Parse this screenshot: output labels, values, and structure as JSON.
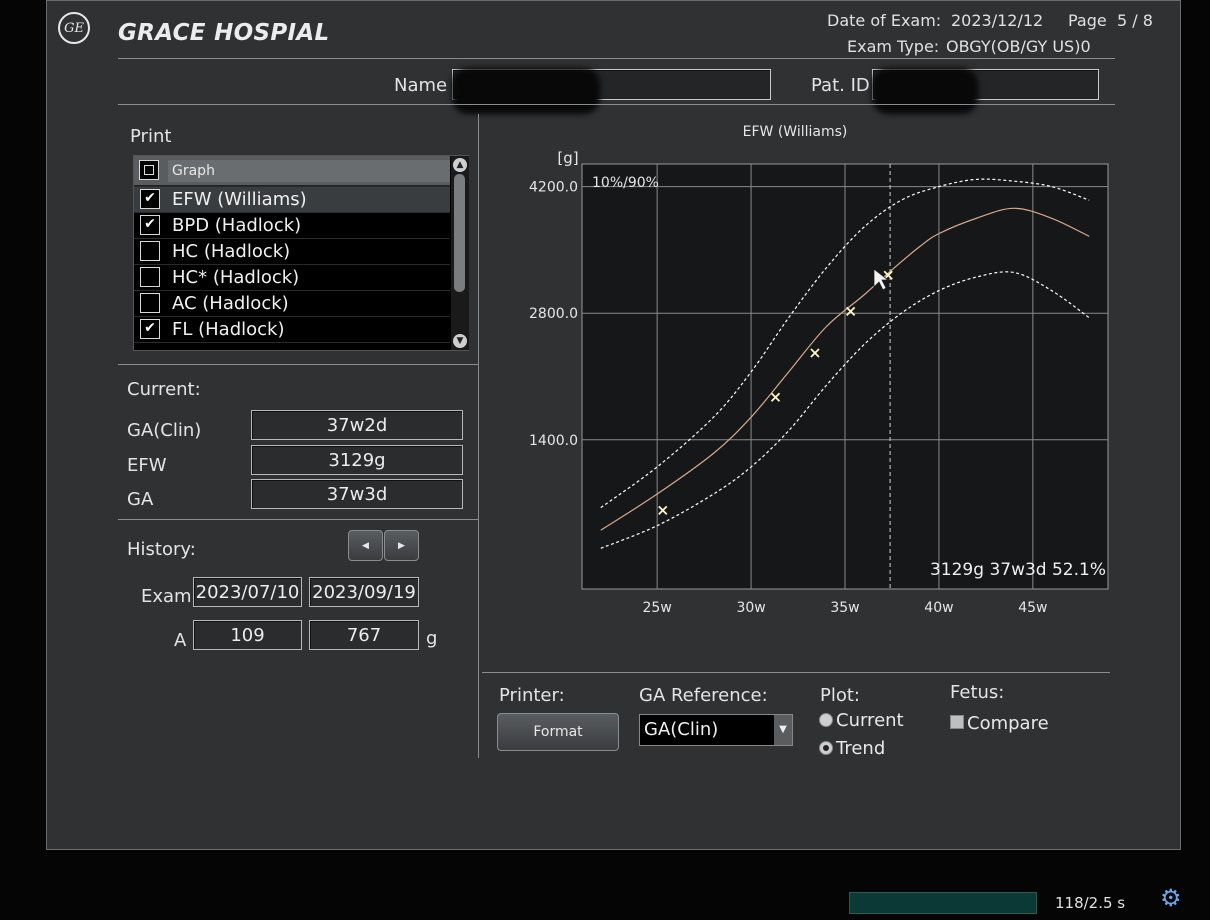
{
  "header": {
    "hospital": "GRACE HOSPIAL",
    "date_label": "Date of Exam:",
    "date_value": "2023/12/12",
    "page_label": "Page",
    "page_value": "5 / 8",
    "exam_type_label": "Exam Type:",
    "exam_type_value": "OBGY(OB/GY US)0",
    "name_label": "Name",
    "patid_label": "Pat. ID"
  },
  "print": {
    "title": "Print",
    "header_label": "Graph",
    "items": [
      {
        "label": "EFW (Williams)",
        "checked": true,
        "selected": true
      },
      {
        "label": "BPD (Hadlock)",
        "checked": true
      },
      {
        "label": "HC (Hadlock)",
        "checked": false
      },
      {
        "label": "HC* (Hadlock)",
        "checked": false
      },
      {
        "label": "AC (Hadlock)",
        "checked": false
      },
      {
        "label": "FL (Hadlock)",
        "checked": true
      }
    ]
  },
  "current": {
    "title": "Current:",
    "ga_clin_label": "GA(Clin)",
    "ga_clin_value": "37w2d",
    "efw_label": "EFW",
    "efw_value": "3129g",
    "ga_label": "GA",
    "ga_value": "37w3d"
  },
  "history": {
    "title": "History:",
    "exam_label": "Exam",
    "a_label": "A",
    "unit": "g",
    "exams": [
      "2023/07/10",
      "2023/09/19"
    ],
    "values": [
      "109",
      "767"
    ]
  },
  "bottom": {
    "printer_label": "Printer:",
    "format_button": "Format",
    "ga_ref_label": "GA Reference:",
    "ga_ref_value": "GA(Clin)",
    "plot_label": "Plot:",
    "plot_current": "Current",
    "plot_trend": "Trend",
    "plot_selected": "Trend",
    "fetus_label": "Fetus:",
    "compare_label": "Compare",
    "compare_checked": false
  },
  "status": {
    "timer": "118/2.5 s"
  },
  "chart_data": {
    "type": "line",
    "title": "EFW (Williams)",
    "ylabel": "[g]",
    "annotation": "10%/90%",
    "result_text": "3129g 37w3d 52.1%",
    "xlim": [
      21,
      49
    ],
    "ylim": [
      -250,
      4450
    ],
    "x_ticks": [
      25,
      30,
      35,
      40,
      45
    ],
    "x_tick_labels": [
      "25w",
      "30w",
      "35w",
      "40w",
      "45w"
    ],
    "y_ticks": [
      1400,
      2800,
      4200
    ],
    "y_tick_labels": [
      "1400.0",
      "2800.0",
      "4200.0"
    ],
    "marker_x": 37.4,
    "series": [
      {
        "style": "solid",
        "color": "#d8a88a",
        "x": [
          22,
          25,
          28,
          30,
          32,
          34,
          36,
          37.5,
          39,
          40,
          42,
          44,
          46,
          48
        ],
        "y": [
          400,
          800,
          1250,
          1650,
          2150,
          2650,
          3000,
          3280,
          3540,
          3680,
          3850,
          3960,
          3850,
          3650
        ]
      },
      {
        "style": "dotted",
        "color": "#ffffff",
        "x": [
          22,
          25,
          28,
          30,
          32,
          34,
          36,
          38,
          40,
          42,
          44,
          46,
          48
        ],
        "y": [
          650,
          1100,
          1650,
          2150,
          2750,
          3300,
          3750,
          4050,
          4200,
          4280,
          4260,
          4200,
          4050
        ]
      },
      {
        "style": "dotted",
        "color": "#ffffff",
        "x": [
          22,
          25,
          28,
          30,
          32,
          34,
          36,
          38,
          40,
          42,
          44,
          46,
          48
        ],
        "y": [
          200,
          450,
          800,
          1100,
          1500,
          2000,
          2450,
          2800,
          3050,
          3200,
          3250,
          3050,
          2750
        ]
      }
    ],
    "points": [
      {
        "x": 25.3,
        "y": 620
      },
      {
        "x": 31.3,
        "y": 1870
      },
      {
        "x": 33.4,
        "y": 2360
      },
      {
        "x": 35.3,
        "y": 2820
      },
      {
        "x": 37.3,
        "y": 3220
      }
    ]
  }
}
